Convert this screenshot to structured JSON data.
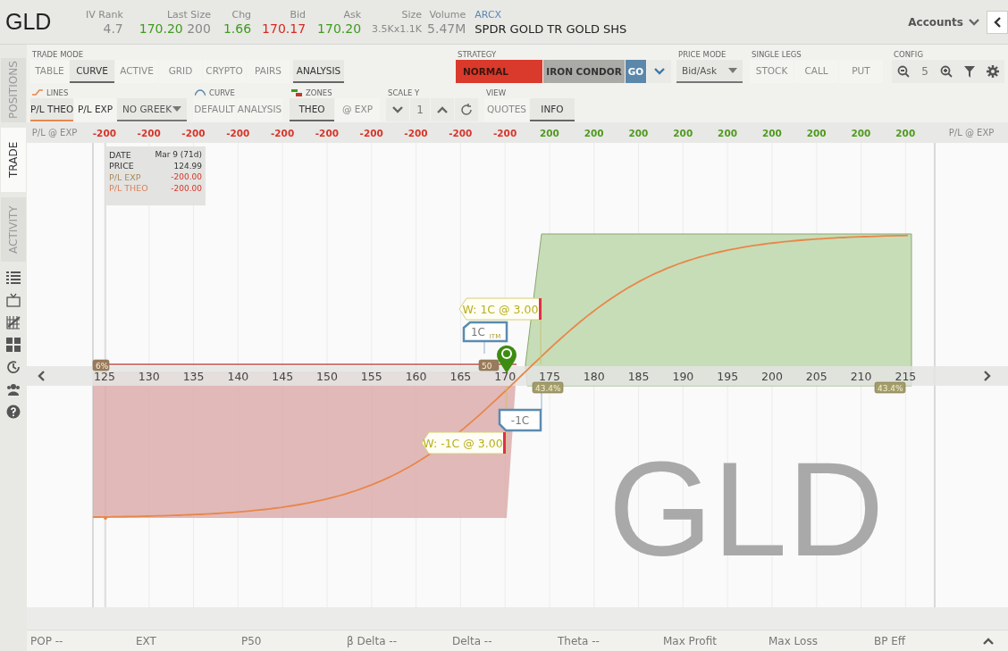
{
  "header": {
    "symbol": "GLD",
    "quotes": [
      {
        "label": "IV Rank",
        "value": "4.7",
        "color": "#8a8a8a",
        "kind": "price"
      },
      {
        "label": "Last Size",
        "value": "170.20",
        "extra": "200",
        "color": "#3f9b1f",
        "kind": "price"
      },
      {
        "label": "Chg",
        "value": "1.66",
        "color": "#3f9b1f",
        "kind": "price"
      },
      {
        "label": "Bid",
        "value": "170.17",
        "color": "#d42a1f",
        "kind": "price"
      },
      {
        "label": "Ask",
        "value": "170.20",
        "color": "#3f9b1f",
        "kind": "price"
      },
      {
        "label": "Size",
        "value": "3.5Kx1.1K",
        "color": "#8a8a8a",
        "kind": "compact"
      },
      {
        "label": "Volume",
        "value": "5.47M",
        "color": "#8a8a8a",
        "kind": "price"
      }
    ],
    "exchange": "ARCX",
    "description": "SPDR GOLD TR GOLD SHS",
    "accounts": "Accounts"
  },
  "sidebar": {
    "tabs": [
      {
        "label": "POSITIONS",
        "selected": false
      },
      {
        "label": "TRADE",
        "selected": true
      },
      {
        "label": "ACTIVITY",
        "selected": false
      }
    ]
  },
  "toolbar": {
    "trade_mode": {
      "label": "TRADE MODE",
      "options": [
        {
          "label": "TABLE",
          "selected": false
        },
        {
          "label": "CURVE",
          "selected": true
        },
        {
          "label": "ACTIVE",
          "selected": false
        },
        {
          "label": "GRID",
          "selected": false
        },
        {
          "label": "CRYPTO",
          "selected": false
        },
        {
          "label": "PAIRS",
          "selected": false
        },
        {
          "label": "ANALYSIS",
          "selected": true
        }
      ]
    },
    "strategy": {
      "label": "STRATEGY",
      "primary": "NORMAL",
      "secondary": "IRON CONDOR",
      "go": "GO"
    },
    "price_mode": {
      "label": "PRICE MODE",
      "value": "Bid/Ask"
    },
    "single_legs": {
      "label": "SINGLE LEGS",
      "buttons": [
        "STOCK",
        "CALL",
        "PUT"
      ]
    },
    "config": {
      "label": "CONFIG",
      "value": "5"
    },
    "lines": {
      "label": "LINES",
      "options": [
        {
          "label": "P/L THEO",
          "selected": true
        },
        {
          "label": "P/L EXP",
          "selected": false
        }
      ],
      "greek": "NO GREEK"
    },
    "curve": {
      "label": "CURVE",
      "options": [
        {
          "label": "DEFAULT",
          "selected": false
        },
        {
          "label": "ANALYSIS",
          "selected": false
        }
      ]
    },
    "zones": {
      "label": "ZONES",
      "options": [
        {
          "label": "THEO",
          "selected": true
        },
        {
          "label": "@ EXP",
          "selected": false
        }
      ]
    },
    "scale_y": {
      "label": "SCALE Y",
      "value": "1"
    },
    "view": {
      "label": "VIEW",
      "options": [
        {
          "label": "QUOTES",
          "selected": false
        },
        {
          "label": "INFO",
          "selected": true
        }
      ]
    }
  },
  "chart": {
    "row_label": "P/L @ EXP",
    "row_label_right": "P/L @ EXP",
    "pl_values": [
      {
        "text": "-200",
        "color": "#d7352a"
      },
      {
        "text": "-200",
        "color": "#d7352a"
      },
      {
        "text": "-200",
        "color": "#d7352a"
      },
      {
        "text": "-200",
        "color": "#d7352a"
      },
      {
        "text": "-200",
        "color": "#d7352a"
      },
      {
        "text": "-200",
        "color": "#d7352a"
      },
      {
        "text": "-200",
        "color": "#d7352a"
      },
      {
        "text": "-200",
        "color": "#d7352a"
      },
      {
        "text": "-200",
        "color": "#d7352a"
      },
      {
        "text": "-200",
        "color": "#d7352a"
      },
      {
        "text": "200",
        "color": "#4f9a1e"
      },
      {
        "text": "200",
        "color": "#4f9a1e"
      },
      {
        "text": "200",
        "color": "#4f9a1e"
      },
      {
        "text": "200",
        "color": "#4f9a1e"
      },
      {
        "text": "200",
        "color": "#4f9a1e"
      },
      {
        "text": "200",
        "color": "#4f9a1e"
      },
      {
        "text": "200",
        "color": "#4f9a1e"
      },
      {
        "text": "200",
        "color": "#4f9a1e"
      },
      {
        "text": "200",
        "color": "#4f9a1e"
      }
    ],
    "x_ticks": [
      "125",
      "130",
      "135",
      "140",
      "145",
      "150",
      "155",
      "160",
      "165",
      "170",
      "175",
      "180",
      "185",
      "190",
      "195",
      "200",
      "205",
      "210",
      "215"
    ],
    "symbol_mark": "GLD",
    "info": [
      {
        "label": "DATE",
        "value": "Mar 9 (71d)",
        "kind": "plain"
      },
      {
        "label": "PRICE",
        "value": "124.99",
        "kind": "plain"
      },
      {
        "label": "P/L EXP",
        "value": "-200.00",
        "kind": "exp"
      },
      {
        "label": "P/L THEO",
        "value": "-200.00",
        "kind": "theo"
      }
    ],
    "legs": [
      {
        "kind": "order",
        "text": "W: 1C @ 3.00"
      },
      {
        "kind": "position",
        "text": "1C",
        "badge": "ITM"
      },
      {
        "kind": "position_short",
        "text": "-1C"
      },
      {
        "kind": "order_short",
        "text": "W: -1C @ 3.00"
      }
    ],
    "probabilities": [
      {
        "text": "6%",
        "kind": "loss"
      },
      {
        "text": "50",
        "kind": "loss"
      },
      {
        "text": "43.4%",
        "kind": "gain"
      },
      {
        "text": "43.4%",
        "kind": "gain"
      }
    ]
  },
  "status_bar": [
    "POP --",
    "EXT",
    "P50",
    "β Delta --",
    "Delta --",
    "Theta --",
    "Max Profit",
    "Max Loss",
    "BP Eff"
  ]
}
